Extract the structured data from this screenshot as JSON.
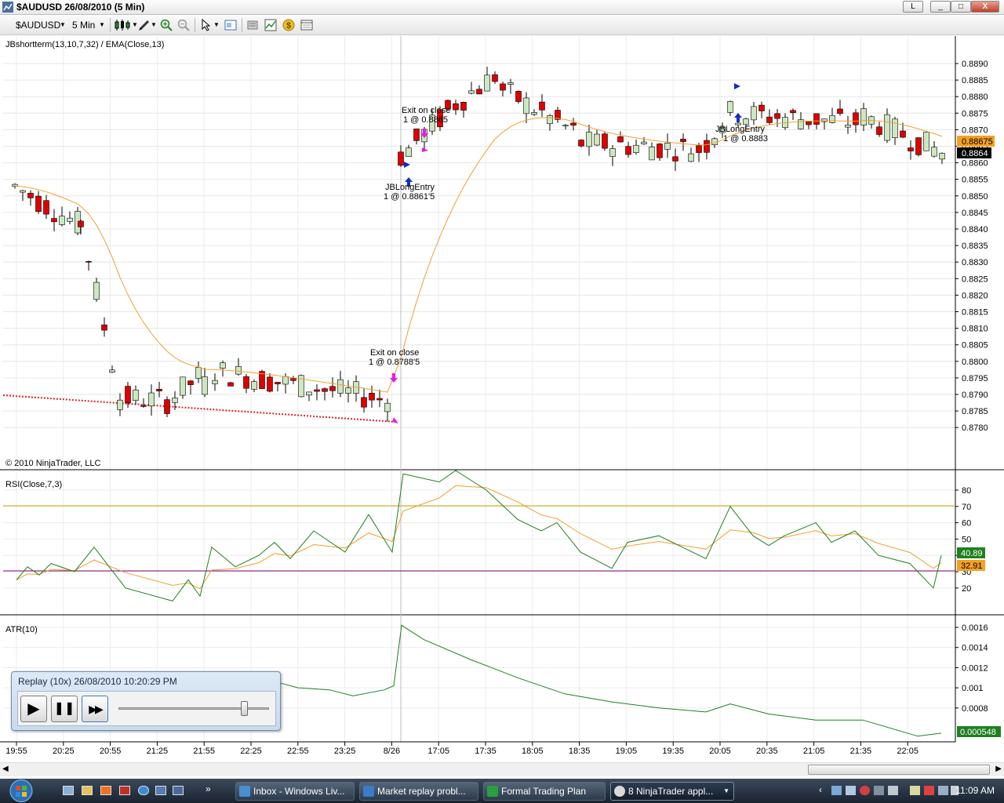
{
  "window": {
    "title": "$AUDUSD  26/08/2010 (5 Min)",
    "controls": [
      "L",
      "_",
      "□",
      "X"
    ]
  },
  "toolbar": {
    "instrument": "$AUDUSD",
    "interval": "5 Min"
  },
  "price_panel": {
    "label": "JBshortterm(13,10,7,32) / EMA(Close,13)",
    "copyright": "© 2010 NinjaTrader, LLC",
    "ticks": [
      "0.8890",
      "0.8885",
      "0.8880",
      "0.8875",
      "0.8870",
      "0.8865",
      "0.8860",
      "0.8855",
      "0.8850",
      "0.8845",
      "0.8840",
      "0.8835",
      "0.8830",
      "0.8825",
      "0.8820",
      "0.8815",
      "0.8810",
      "0.8805",
      "0.8800",
      "0.8795",
      "0.8790",
      "0.8785",
      "0.8780"
    ],
    "ema_label": "0.88675",
    "price_label": "0.8864",
    "colors": {
      "up": "#cde8c0",
      "down": "#e00000",
      "ema": "#f0a030",
      "ema_badge": "#f5a020",
      "price_badge": "#000000"
    },
    "annotations": [
      {
        "id": "exit1",
        "line1": "Exit on close",
        "line2": "1 @ 0.8788'5"
      },
      {
        "id": "exit2",
        "line1": "Exit on close",
        "line2": "1 @ 0.8865"
      },
      {
        "id": "entry1",
        "line1": "JBLongEntry",
        "line2": "1 @ 0.8861'5"
      },
      {
        "id": "entry2",
        "line1": "JBLongEntry",
        "line2": "1 @ 0.8883"
      }
    ]
  },
  "rsi_panel": {
    "label": "RSI(Close,7,3)",
    "ticks": [
      "80",
      "70",
      "60",
      "50",
      "40",
      "30",
      "20"
    ],
    "value_label": "40.89",
    "avg_label": "32.91",
    "colors": {
      "rsi": "#208020",
      "avg": "#f0a030",
      "upper": "#c8a800",
      "lower": "#800080",
      "value_badge": "#208020",
      "avg_badge": "#f5a020"
    }
  },
  "atr_panel": {
    "label": "ATR(10)",
    "ticks": [
      "0.0016",
      "0.0014",
      "0.0012",
      "0.001",
      "0.0008"
    ],
    "value_label": "0.000548",
    "colors": {
      "atr": "#208020",
      "badge": "#208020"
    }
  },
  "time_axis": [
    "19:55",
    "20:25",
    "20:55",
    "21:25",
    "21:55",
    "22:25",
    "22:55",
    "23:25",
    "8/26",
    "17:05",
    "17:35",
    "18:05",
    "18:35",
    "19:05",
    "19:35",
    "20:05",
    "20:35",
    "21:05",
    "21:35",
    "22:05"
  ],
  "replay": {
    "title": "Replay (10x) 26/08/2010 10:20:29 PM",
    "play": "▶",
    "pause": "❚❚",
    "fast_forward": "▶▶",
    "speed_position": 0.84
  },
  "taskbar": {
    "items": [
      {
        "label": "Inbox - Windows Liv...",
        "color": "#4a90d0"
      },
      {
        "label": "Market replay probl...",
        "color": "#3a7cc8"
      },
      {
        "label": "Formal Trading Plan",
        "color": "#2aa040"
      },
      {
        "label": "8  NinjaTrader appl...",
        "color": "#d8d8d8"
      }
    ],
    "clock": "11:09 AM"
  }
}
